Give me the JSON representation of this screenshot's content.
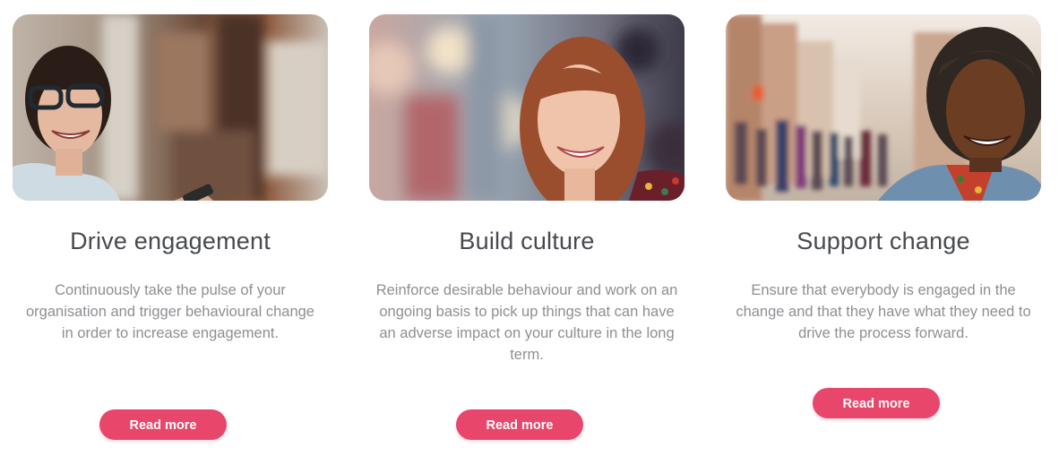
{
  "cards": [
    {
      "image_alt": "Smiling woman with glasses holding a phone",
      "title": "Drive engagement",
      "description": "Continuously take the pulse of your organisation and trigger behavioural change in order to increase engagement.",
      "button_label": "Read more"
    },
    {
      "image_alt": "Smiling woman with bangs outdoors",
      "title": "Build culture",
      "description": "Reinforce desirable behaviour and work on an ongoing basis to pick up things that can have an adverse impact on your culture in the long term.",
      "button_label": "Read more"
    },
    {
      "image_alt": "Smiling man in a busy street",
      "title": "Support change",
      "description": "Ensure that everybody is engaged in the change and that they have what they need to drive the process forward.",
      "button_label": "Read more"
    }
  ],
  "colors": {
    "button": "#e8466b",
    "title": "#474a4f",
    "text": "#8d8f93"
  }
}
